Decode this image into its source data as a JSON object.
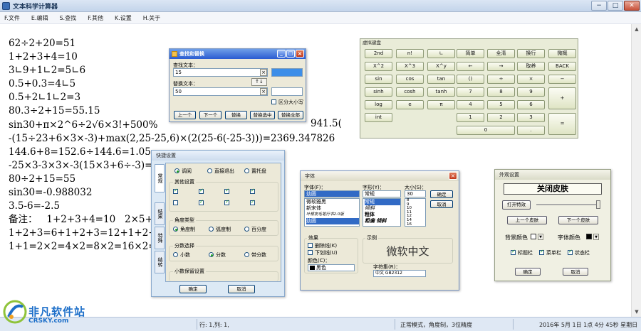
{
  "window": {
    "title": "文本科学计算器",
    "controls": {
      "minimize": "−",
      "maximize": "□",
      "close": "✕"
    }
  },
  "menu": [
    "F.文件",
    "E.编辑",
    "S.查找",
    "F.其他",
    "K.设置",
    "H.关于"
  ],
  "document": {
    "lines": [
      "62÷2+20=51",
      "1+2+3+4=10",
      "3∟9+1∟2=5∟6",
      "0.5+0.3=4∟5",
      "0.5+2∟1∟2=3",
      "80.3÷2+15=55.15",
      "sin30+π×2^6÷2√6×3!+500%",
      "-(15÷23+6×3×-3)+max(2,25-25,6)×(2(25-6(-25-3)))=2369.347826",
      "144.6+8=152.6÷144.6=1.05:",
      "-25×3-3×3×-3(15×3+6÷-3)=",
      "80÷2+15=55",
      "sin30=-0.988032",
      "3.5-6=-2.5",
      "备注：   1+2+3+4=10   2×5+",
      "1+2+3=6+1+2+3=12+1+2+3",
      "1+1=2×2=4×2=8×2=16×2=3"
    ],
    "overflow_fragment": "941.5("
  },
  "status": {
    "position": "行: 1,列: 1,",
    "mode": "正常模式，角度制，3位精度",
    "datetime": "2016年 5月 1日 1点 4分 45秒 星期日"
  },
  "find_replace": {
    "title": "查找和替换",
    "find_label": "查找文本：",
    "find_value": "15",
    "replace_label": "替换文本：",
    "replace_value": "50",
    "swap": "↑↓",
    "clear": "×",
    "match_case": "区分大小写",
    "buttons": [
      "上一个",
      "下一个",
      "替换",
      "替换选中",
      "替换全部"
    ]
  },
  "keyboard": {
    "title": "虚拟键盘",
    "rows": [
      [
        "2nd",
        "n!",
        "∟",
        "简单",
        "全清",
        "换行",
        "微概"
      ],
      [
        "X^2",
        "X^3",
        "X^y",
        "←",
        "→",
        "取养",
        "BACK"
      ],
      [
        "sin",
        "cos",
        "tan",
        "()",
        "÷",
        "×",
        "−"
      ],
      [
        "sinh",
        "cosh",
        "tanh",
        "7",
        "8",
        "9",
        "+"
      ],
      [
        "log",
        "e",
        "π",
        "4",
        "5",
        "6",
        ""
      ],
      [
        "int",
        "",
        "",
        "1",
        "2",
        "3",
        "="
      ],
      [
        "",
        "",
        "",
        "0",
        ".",
        "",
        ""
      ]
    ]
  },
  "quick_settings": {
    "title": "快捷设置",
    "tabs": [
      "常规",
      "结果",
      "特殊",
      "结转"
    ],
    "options_top": [
      "调阅",
      "直接退出",
      "置托盘"
    ],
    "other_title": "其他设置",
    "angle_title": "角度类型",
    "angle": [
      "角度制",
      "弧度制",
      "百分度"
    ],
    "fraction_title": "分数选择",
    "fraction": [
      "小数",
      "分数",
      "带分数"
    ],
    "decimal_title": "小数保留设置",
    "ok": "确定",
    "cancel": "取消"
  },
  "font_dialog": {
    "title": "字体",
    "font_label": "字体(F)：",
    "font_value": "幼圆",
    "fonts": [
      "微软雅黑",
      "新宋体",
      "叶根友毛笔行书2.0版",
      "幼圆"
    ],
    "style_label": "字形(Y)：",
    "style_value": "常规",
    "styles": [
      "常规",
      "倾斜",
      "粗体",
      "粗偏 倾斜"
    ],
    "size_label": "大小(S)：",
    "size_value": "30",
    "sizes": [
      "8",
      "9",
      "10",
      "11",
      "12",
      "14",
      "16"
    ],
    "ok": "确定",
    "cancel": "取消",
    "effects_title": "效果",
    "strikeout": "删除线(K)",
    "underline": "下划线(U)",
    "color_label": "颜色(C)：",
    "color_value": "黑色",
    "sample_title": "示例",
    "sample_text": "微软中文",
    "script_label": "字符集(R)：",
    "script_value": "中文 GB2312"
  },
  "skin_dialog": {
    "title": "外观设置",
    "close_skin": "关闭皮肤",
    "open_effects": "打开特效",
    "prev_skin": "上一个皮肤",
    "next_skin": "下一个皮肤",
    "bg_color": "背景颜色",
    "font_color": "字体颜色",
    "toolbar": "标题栏",
    "menubar": "菜单栏",
    "statusbar": "状态栏",
    "ok": "确定",
    "cancel": "取消"
  },
  "watermark": {
    "name": "非凡软件站",
    "sub": "CRSKY.com"
  },
  "colors": {
    "accent": "#2a5bd1",
    "dialog_bg": "#ece9d8",
    "keyboard_bg": "#e9ecd8",
    "watermark": "#1d6fc9"
  }
}
